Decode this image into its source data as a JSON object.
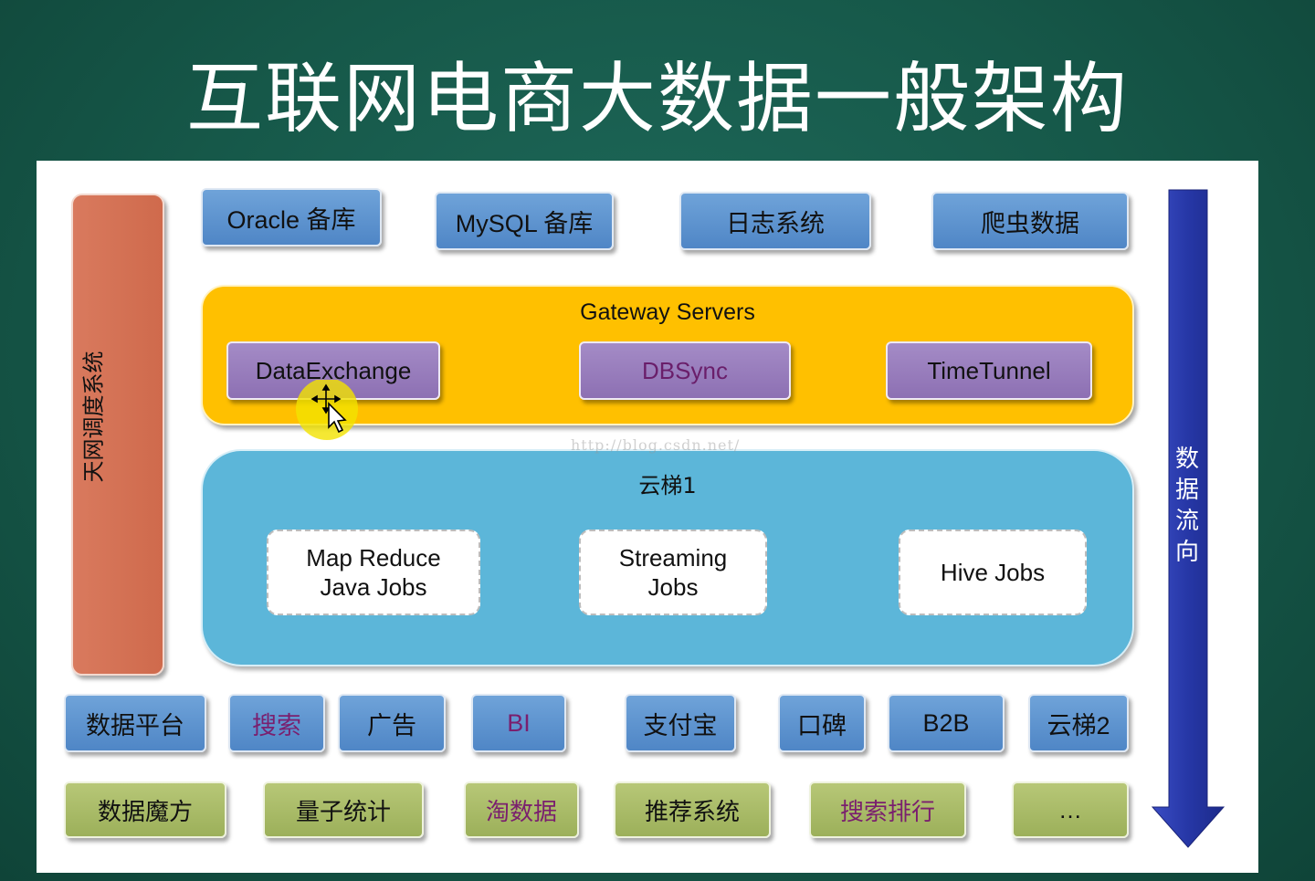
{
  "title": "互联网电商大数据一般架构",
  "scheduler": {
    "label": "天网调度系统",
    "color": "#d46f52"
  },
  "sources": [
    {
      "label": "Oracle 备库",
      "tone": "normal"
    },
    {
      "label": "MySQL 备库",
      "tone": "normal"
    },
    {
      "label": "日志系统",
      "tone": "normal"
    },
    {
      "label": "爬虫数据",
      "tone": "normal"
    }
  ],
  "gateway": {
    "title": "Gateway Servers",
    "color": "#ffc000",
    "items": [
      {
        "label": "DataExchange"
      },
      {
        "label": "DBSync"
      },
      {
        "label": "TimeTunnel"
      }
    ]
  },
  "cloud": {
    "title": "云梯1",
    "color": "#5cb6d9",
    "jobs": [
      {
        "label": "Map Reduce\nJava Jobs"
      },
      {
        "label": "Streaming\nJobs"
      },
      {
        "label": "Hive Jobs"
      }
    ]
  },
  "apps_row": [
    {
      "label": "数据平台"
    },
    {
      "label": "搜索"
    },
    {
      "label": "广告"
    },
    {
      "label": "BI"
    },
    {
      "label": "支付宝"
    },
    {
      "label": "口碑"
    },
    {
      "label": "B2B"
    },
    {
      "label": "云梯2"
    }
  ],
  "products_row": [
    {
      "label": "数据魔方"
    },
    {
      "label": "量子统计"
    },
    {
      "label": "淘数据"
    },
    {
      "label": "推荐系统"
    },
    {
      "label": "搜索排行"
    },
    {
      "label": "…"
    }
  ],
  "flow": {
    "label": "数据流向",
    "color": "#2f3fb0"
  },
  "watermark": "http://blog.csdn.net/"
}
